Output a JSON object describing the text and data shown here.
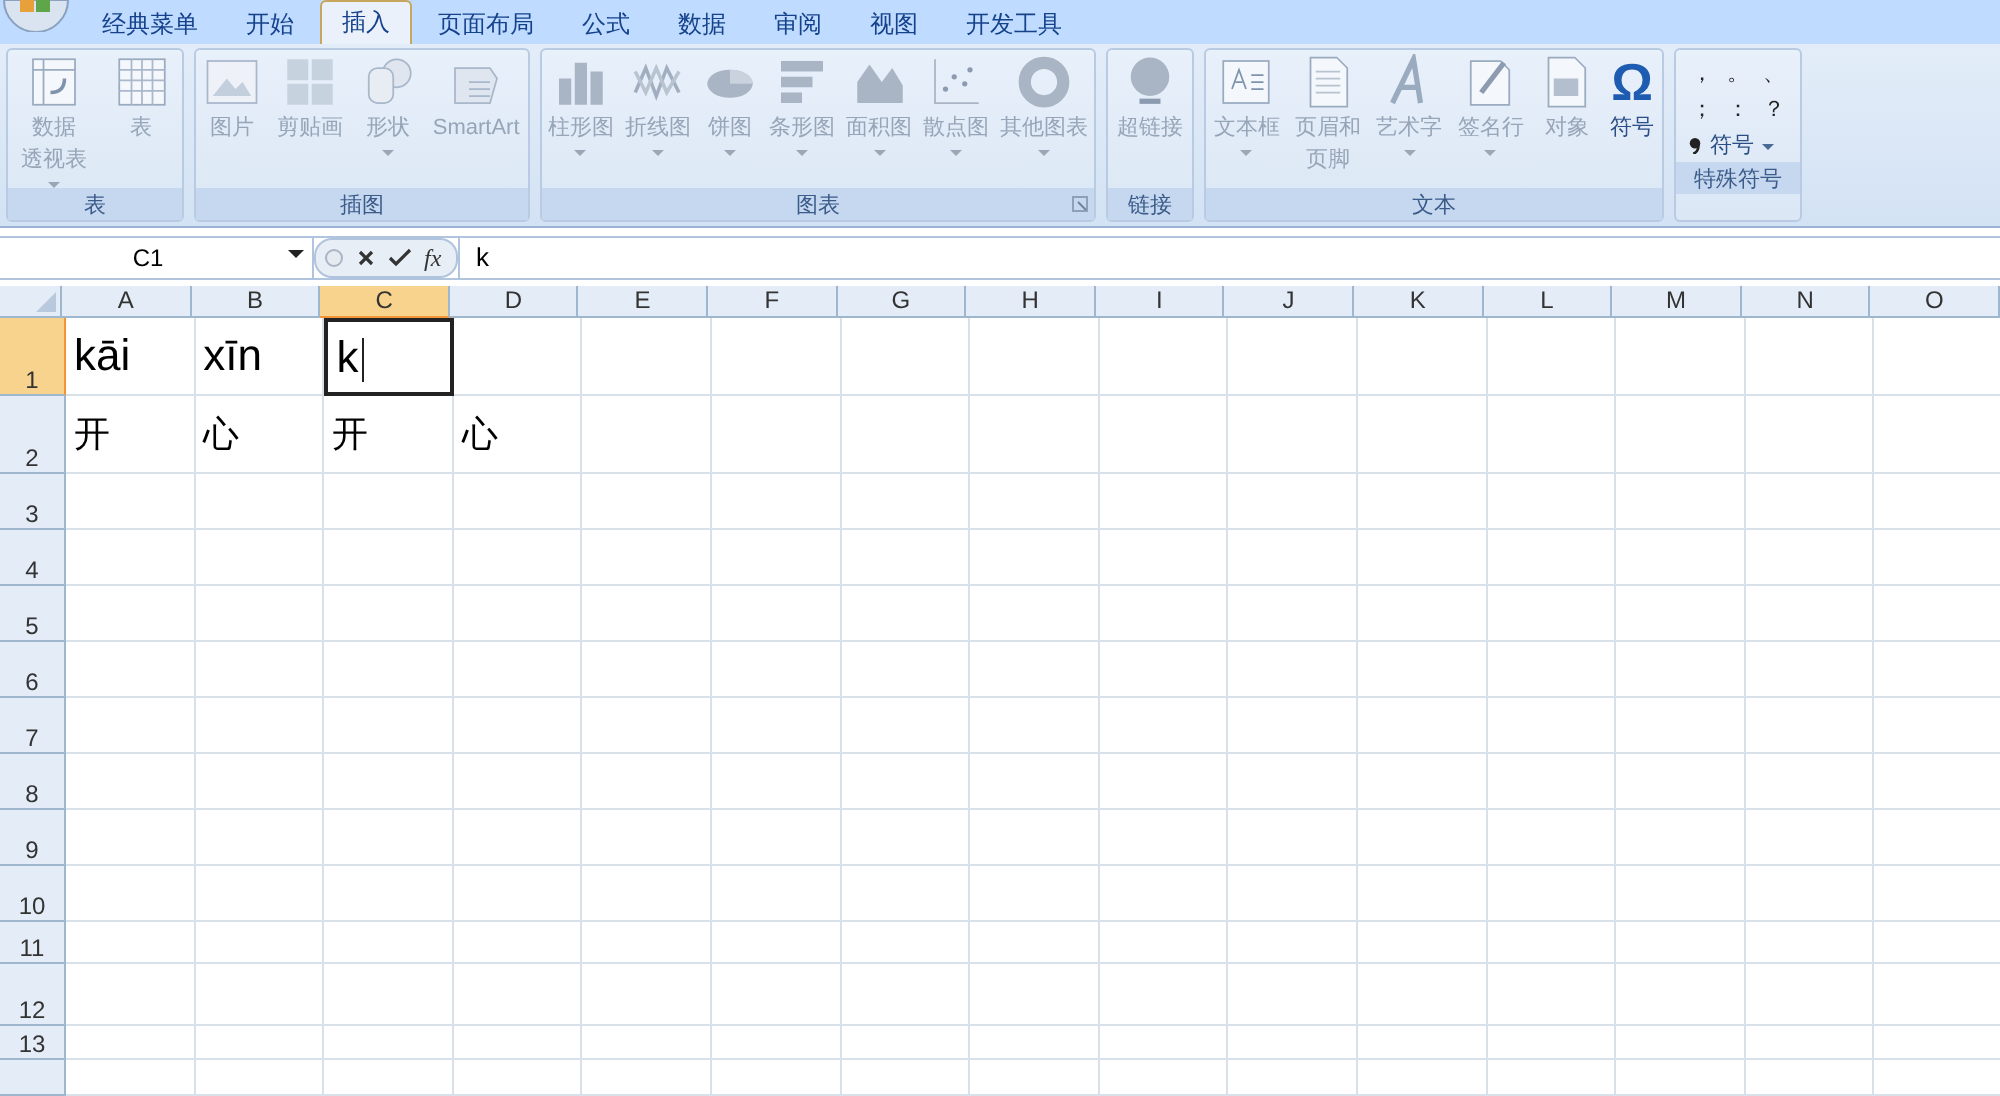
{
  "tabs": [
    {
      "label": "经典菜单",
      "selected": false
    },
    {
      "label": "开始",
      "selected": false
    },
    {
      "label": "插入",
      "selected": true
    },
    {
      "label": "页面布局",
      "selected": false
    },
    {
      "label": "公式",
      "selected": false
    },
    {
      "label": "数据",
      "selected": false
    },
    {
      "label": "审阅",
      "selected": false
    },
    {
      "label": "视图",
      "selected": false
    },
    {
      "label": "开发工具",
      "selected": false
    }
  ],
  "ribbon": [
    {
      "label": "表",
      "items": [
        {
          "lines": [
            "数据",
            "透视表"
          ],
          "disabled": true,
          "dropdown": true
        },
        {
          "label": "表",
          "disabled": true,
          "dropdown": false
        }
      ]
    },
    {
      "label": "插图",
      "items": [
        {
          "label": "图片",
          "disabled": true,
          "dropdown": false
        },
        {
          "label": "剪贴画",
          "disabled": true,
          "dropdown": false
        },
        {
          "label": "形状",
          "disabled": true,
          "dropdown": true
        },
        {
          "label": "SmartArt",
          "disabled": true,
          "dropdown": false
        }
      ]
    },
    {
      "label": "图表",
      "launcher": true,
      "items": [
        {
          "label": "柱形图",
          "disabled": true,
          "dropdown": true
        },
        {
          "label": "折线图",
          "disabled": true,
          "dropdown": true
        },
        {
          "label": "饼图",
          "disabled": true,
          "dropdown": true
        },
        {
          "label": "条形图",
          "disabled": true,
          "dropdown": true
        },
        {
          "label": "面积图",
          "disabled": true,
          "dropdown": true
        },
        {
          "label": "散点图",
          "disabled": true,
          "dropdown": true
        },
        {
          "label": "其他图表",
          "disabled": true,
          "dropdown": true
        }
      ]
    },
    {
      "label": "链接",
      "items": [
        {
          "label": "超链接",
          "disabled": true,
          "dropdown": false
        }
      ]
    },
    {
      "label": "文本",
      "items": [
        {
          "label": "文本框",
          "disabled": true,
          "dropdown": true
        },
        {
          "lines": [
            "页眉和",
            "页脚"
          ],
          "disabled": true,
          "dropdown": false
        },
        {
          "label": "艺术字",
          "disabled": true,
          "dropdown": true
        },
        {
          "label": "签名行",
          "disabled": true,
          "dropdown": true
        },
        {
          "label": "对象",
          "disabled": true,
          "dropdown": false
        },
        {
          "label": "符号",
          "glyph": "Ω",
          "disabled": false,
          "dropdown": false
        }
      ]
    }
  ],
  "special_symbols": {
    "label": "特殊符号",
    "symbols": [
      "，",
      "。",
      "、",
      "；",
      "：",
      "？"
    ],
    "menu": {
      "label": "符号",
      "dropdown": true
    }
  },
  "formula_bar": {
    "name_box": "C1",
    "function_button": "fx",
    "value": "k"
  },
  "sheet": {
    "columns": [
      {
        "label": "A",
        "selected": false
      },
      {
        "label": "B",
        "selected": false
      },
      {
        "label": "C",
        "selected": true
      },
      {
        "label": "D",
        "selected": false
      },
      {
        "label": "E",
        "selected": false
      },
      {
        "label": "F",
        "selected": false
      },
      {
        "label": "G",
        "selected": false
      },
      {
        "label": "H",
        "selected": false
      },
      {
        "label": "I",
        "selected": false
      },
      {
        "label": "J",
        "selected": false
      },
      {
        "label": "K",
        "selected": false
      },
      {
        "label": "L",
        "selected": false
      },
      {
        "label": "M",
        "selected": false
      },
      {
        "label": "N",
        "selected": false
      },
      {
        "label": "O",
        "selected": false
      }
    ],
    "rows": [
      {
        "label": "1",
        "selected": true,
        "cells": [
          {
            "text": "kāi"
          },
          {
            "text": "xīn"
          },
          {
            "text": "k",
            "editing": true
          }
        ]
      },
      {
        "label": "2",
        "selected": false,
        "cells": [
          {
            "text": "开"
          },
          {
            "text": "心"
          },
          {
            "text": "开"
          },
          {
            "text": "心"
          }
        ]
      },
      {
        "label": "3",
        "selected": false,
        "cells": []
      },
      {
        "label": "4",
        "selected": false,
        "cells": []
      },
      {
        "label": "5",
        "selected": false,
        "cells": []
      },
      {
        "label": "6",
        "selected": false,
        "cells": []
      },
      {
        "label": "7",
        "selected": false,
        "cells": []
      },
      {
        "label": "8",
        "selected": false,
        "cells": []
      },
      {
        "label": "9",
        "selected": false,
        "cells": []
      },
      {
        "label": "10",
        "selected": false,
        "cells": []
      },
      {
        "label": "11",
        "selected": false,
        "cells": []
      },
      {
        "label": "12",
        "selected": false,
        "cells": []
      },
      {
        "label": "13",
        "selected": false,
        "cells": []
      }
    ]
  }
}
